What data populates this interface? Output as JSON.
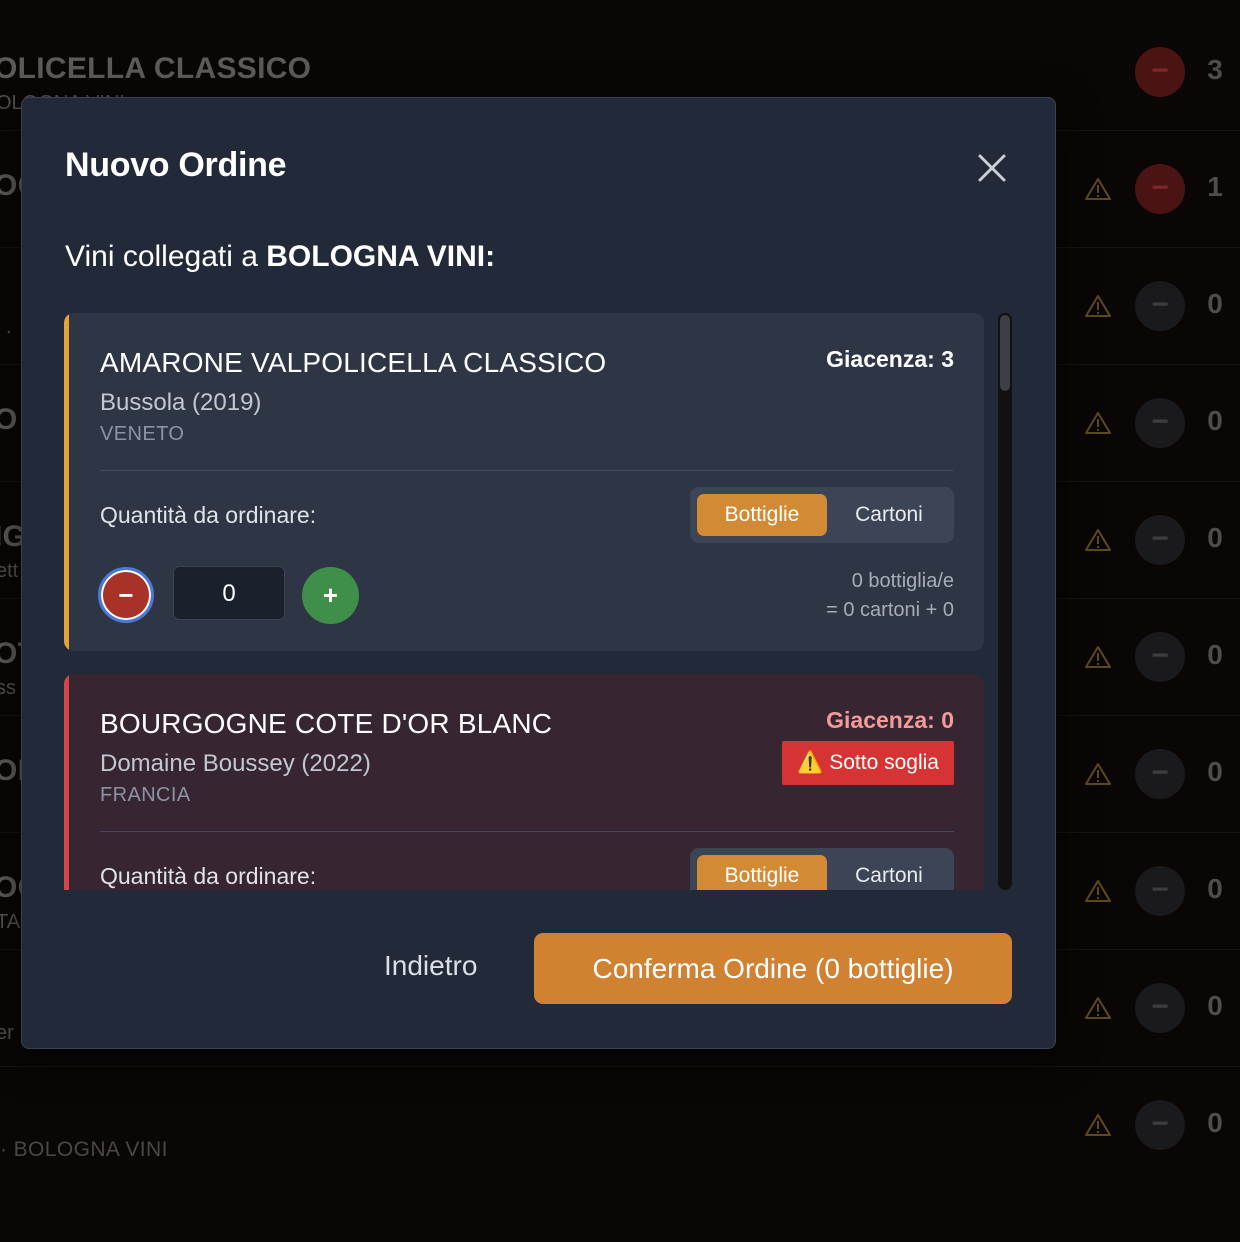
{
  "background": {
    "rows": [
      {
        "title": "OLICELLA CLASSICO",
        "subtitle": "OLOGNA VINI",
        "count": "3",
        "warning": false,
        "minus_style": "red"
      },
      {
        "title": "OC",
        "subtitle": "",
        "count": "1",
        "warning": true,
        "minus_style": "red"
      },
      {
        "title": "",
        "subtitle": ".",
        "count": "0",
        "warning": true,
        "minus_style": "dark"
      },
      {
        "title": "O",
        "subtitle": "",
        "count": "0",
        "warning": true,
        "minus_style": "dark"
      },
      {
        "title": "IG",
        "subtitle": "ett",
        "count": "0",
        "warning": true,
        "minus_style": "dark"
      },
      {
        "title": "OT",
        "subtitle": "ss",
        "count": "0",
        "warning": true,
        "minus_style": "dark"
      },
      {
        "title": "ON",
        "subtitle": "",
        "count": "0",
        "warning": true,
        "minus_style": "dark"
      },
      {
        "title": "OC",
        "subtitle": "TA",
        "count": "0",
        "warning": true,
        "minus_style": "dark"
      },
      {
        "title": "",
        "subtitle": "er",
        "count": "0",
        "warning": true,
        "minus_style": "dark"
      },
      {
        "title": "",
        "subtitle": "",
        "count": "0",
        "warning": true,
        "minus_style": "dark"
      }
    ],
    "minus_symbol": "−",
    "bottom_label": "·  BOLOGNA VINI"
  },
  "modal": {
    "title": "Nuovo Ordine",
    "supplier_prefix": "Vini collegati a ",
    "supplier_name": "BOLOGNA VINI",
    "supplier_suffix": ":",
    "wines": [
      {
        "name": "AMARONE VALPOLICELLA CLASSICO",
        "producer": "Bussola (2019)",
        "region": "VENETO",
        "stock": "Giacenza: 3",
        "below_threshold": false,
        "qty_label": "Quantità da ordinare:",
        "unit_bottles": "Bottiglie",
        "unit_cartons": "Cartoni",
        "quantity": "0",
        "summary_line1": "0 bottiglia/e",
        "summary_line2": "= 0 cartoni + 0"
      },
      {
        "name": "BOURGOGNE COTE D'OR BLANC",
        "producer": "Domaine Boussey (2022)",
        "region": "FRANCIA",
        "stock": "Giacenza: 0",
        "below_threshold": true,
        "badge": "⚠️ Sotto soglia",
        "qty_label": "Quantità da ordinare:",
        "unit_bottles": "Bottiglie",
        "unit_cartons": "Cartoni"
      }
    ],
    "stepper_minus": "−",
    "stepper_plus": "+",
    "back_label": "Indietro",
    "confirm_label": "Conferma Ordine (0 bottiglie)"
  },
  "colors": {
    "modal_bg": "#222938",
    "accent_ok": "#e3a33a",
    "accent_low": "#d64545",
    "primary": "#d08232",
    "danger": "#d63434",
    "success": "#3f8f4a"
  }
}
